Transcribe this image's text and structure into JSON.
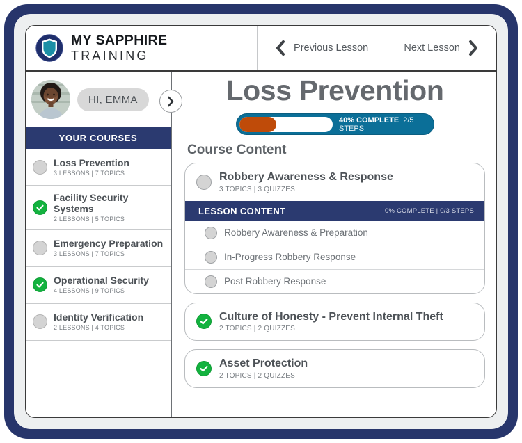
{
  "brand": {
    "line1": "MY SAPPHIRE",
    "line2": "TRAINING",
    "logo_icon": "shield-logo-icon",
    "navy": "#2b3a70",
    "teal": "#1a92a8"
  },
  "header": {
    "prev_label": "Previous Lesson",
    "next_label": "Next Lesson",
    "prev_icon": "chevron-left-icon",
    "next_icon": "chevron-right-icon"
  },
  "sidebar": {
    "greeting": "HI, EMMA",
    "avatar_icon": "user-avatar-photo",
    "section_label": "YOUR COURSES",
    "toggle_icon": "chevron-right-icon",
    "courses": [
      {
        "title": "Loss Prevention",
        "meta": "3 LESSONS | 7 TOPICS",
        "status": "incomplete"
      },
      {
        "title": "Facility Security Systems",
        "meta": "2 LESSONS | 5 TOPICS",
        "status": "complete"
      },
      {
        "title": "Emergency Preparation",
        "meta": "3 LESSONS | 7 TOPICS",
        "status": "incomplete"
      },
      {
        "title": "Operational Security",
        "meta": "4 LESSONS | 9 TOPICS",
        "status": "complete"
      },
      {
        "title": "Identity Verification",
        "meta": "2 LESSONS | 4 TOPICS",
        "status": "incomplete"
      }
    ]
  },
  "main": {
    "course_title": "Loss Prevention",
    "progress": {
      "percent_label": "40% COMPLETE",
      "steps_label": "2/5 STEPS",
      "percent_value": 40,
      "fill_color": "#bf4b09",
      "pill_color": "#0b6f98"
    },
    "content_heading": "Course Content",
    "modules": [
      {
        "title": "Robbery Awareness & Response",
        "meta": "3 TOPICS | 3 QUIZZES",
        "status": "incomplete",
        "expanded": true,
        "lesson_bar": {
          "label": "LESSON CONTENT",
          "meta": "0% COMPLETE | 0/3 STEPS"
        },
        "lessons": [
          {
            "title": "Robbery Awareness & Preparation",
            "status": "incomplete"
          },
          {
            "title": "In-Progress Robbery Response",
            "status": "incomplete"
          },
          {
            "title": "Post Robbery Response",
            "status": "incomplete"
          }
        ]
      },
      {
        "title": "Culture of Honesty - Prevent Internal Theft",
        "meta": "2 TOPICS | 2 QUIZZES",
        "status": "complete",
        "expanded": false,
        "lessons": []
      },
      {
        "title": "Asset Protection",
        "meta": "2 TOPICS | 2 QUIZZES",
        "status": "complete",
        "expanded": false,
        "lessons": []
      }
    ]
  }
}
